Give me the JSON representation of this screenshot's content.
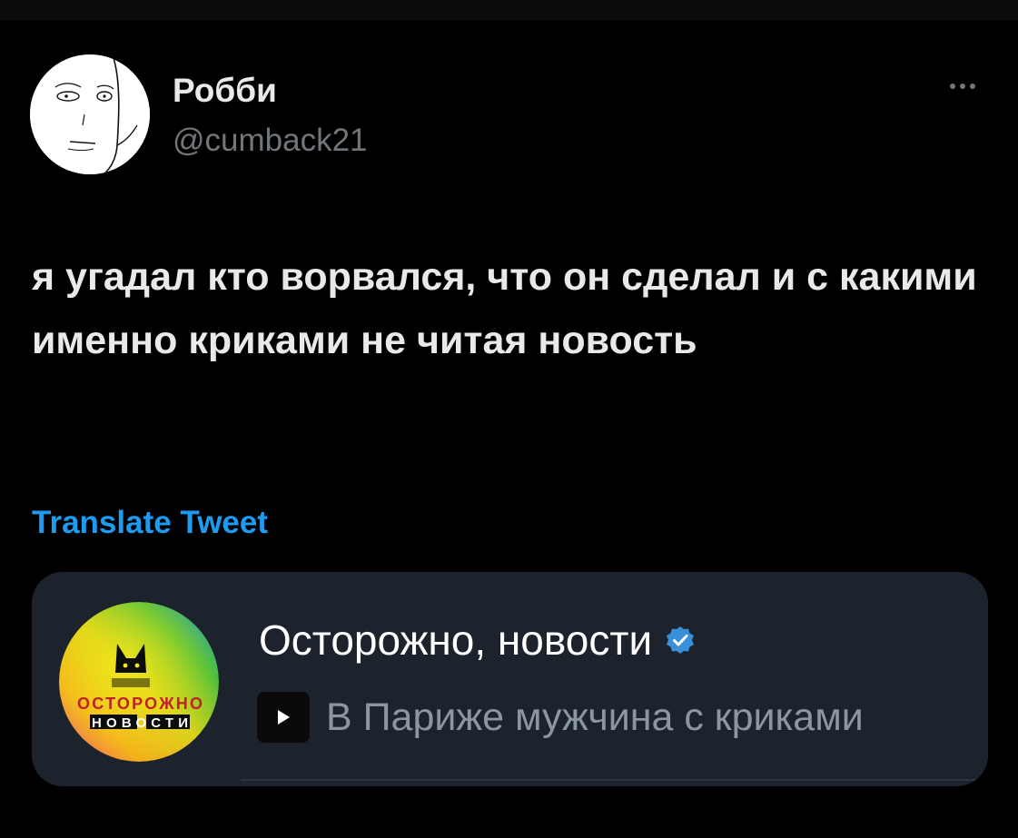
{
  "tweet": {
    "author": {
      "display_name": "Робби",
      "handle": "@cumback21",
      "avatar_icon": "avatar-sketch-face-icon"
    },
    "more_icon": "more-dots-icon",
    "text": "я угадал кто ворвался, что он сделал и с какими именно криками не читая новость",
    "translate_label": "Translate Tweet"
  },
  "embed": {
    "channel_name": "Осторожно, новости",
    "verified_icon": "verified-badge-icon",
    "avatar_logo_text": {
      "line1": "ОСТОРОЖНО",
      "line2": "НОВОСТИ"
    },
    "preview_icon": "play-video-icon",
    "preview_text": "В Париже мужчина с криками"
  },
  "colors": {
    "background": "#000000",
    "text_primary": "#e7e9ea",
    "text_secondary": "#71767b",
    "link_accent": "#1d9bf0",
    "card_background": "#1c232d",
    "verified_blue": "#3a8fd9"
  }
}
